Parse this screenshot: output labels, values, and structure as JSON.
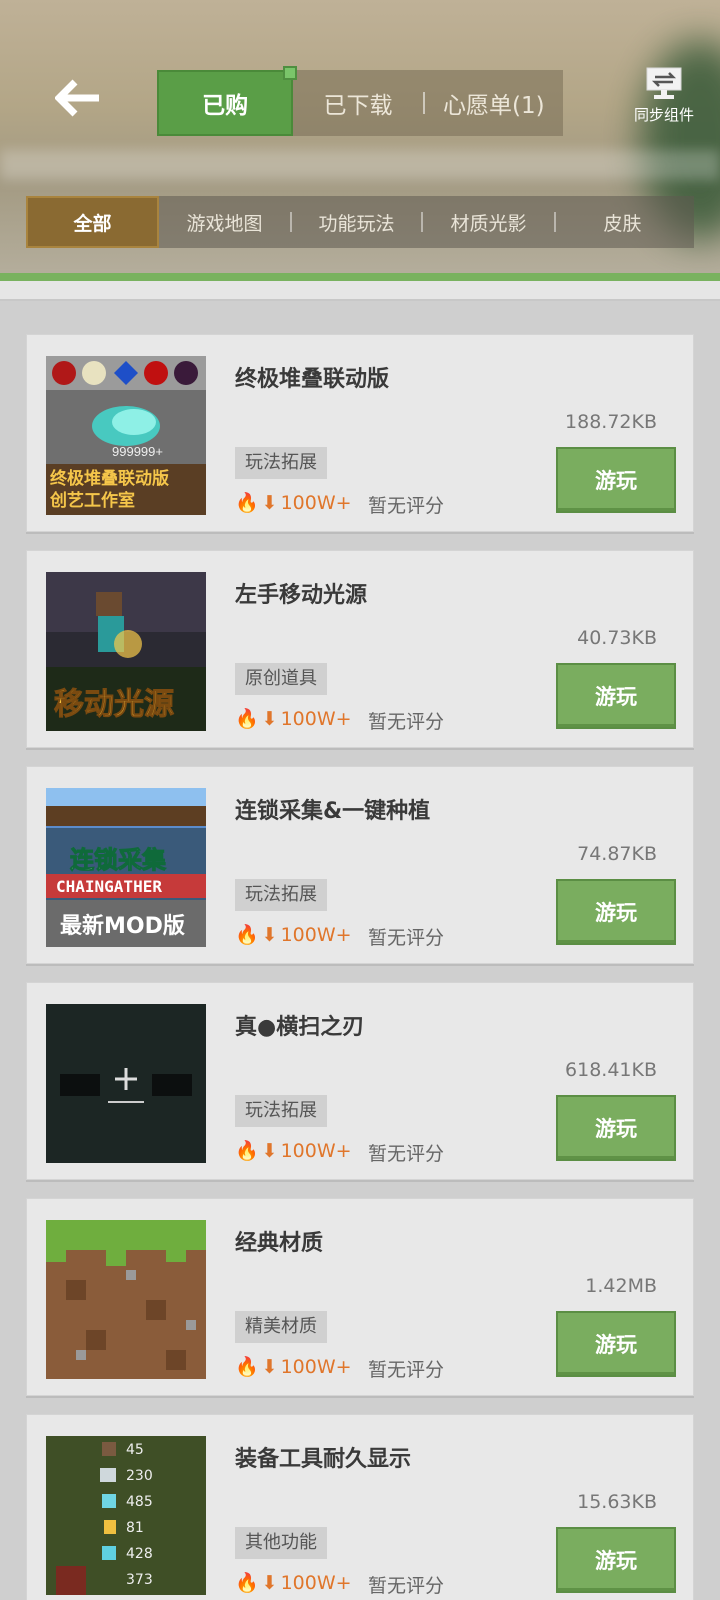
{
  "header": {
    "tabs": [
      {
        "label": "已购",
        "active": true
      },
      {
        "label": "已下载",
        "active": false
      },
      {
        "label": "心愿单(1)",
        "active": false
      }
    ],
    "sync_label": "同步组件"
  },
  "categories": [
    {
      "label": "全部",
      "active": true
    },
    {
      "label": "游戏地图",
      "active": false
    },
    {
      "label": "功能玩法",
      "active": false
    },
    {
      "label": "材质光影",
      "active": false
    },
    {
      "label": "皮肤",
      "active": false
    }
  ],
  "items": [
    {
      "name": "终极堆叠联动版",
      "size": "188.72KB",
      "tag": "玩法拓展",
      "downloads": "100W+",
      "rating": "暂无评分",
      "button": "游玩",
      "thumb_text": [
        "999999+",
        "终极堆叠联动版",
        "创艺工作室"
      ]
    },
    {
      "name": "左手移动光源",
      "size": "40.73KB",
      "tag": "原创道具",
      "downloads": "100W+",
      "rating": "暂无评分",
      "button": "游玩",
      "thumb_text": [
        "移动光源"
      ]
    },
    {
      "name": "连锁采集&一键种植",
      "size": "74.87KB",
      "tag": "玩法拓展",
      "downloads": "100W+",
      "rating": "暂无评分",
      "button": "游玩",
      "thumb_text": [
        "连锁采集",
        "CHAINGATHER",
        "最新MOD版"
      ]
    },
    {
      "name": "真●横扫之刃",
      "size": "618.41KB",
      "tag": "玩法拓展",
      "downloads": "100W+",
      "rating": "暂无评分",
      "button": "游玩",
      "thumb_text": []
    },
    {
      "name": "经典材质",
      "size": "1.42MB",
      "tag": "精美材质",
      "downloads": "100W+",
      "rating": "暂无评分",
      "button": "游玩",
      "thumb_text": []
    },
    {
      "name": "装备工具耐久显示",
      "size": "15.63KB",
      "tag": "其他功能",
      "downloads": "100W+",
      "rating": "暂无评分",
      "button": "游玩",
      "thumb_text": [
        "45",
        "230",
        "485",
        "81",
        "428",
        "373"
      ]
    }
  ],
  "colors": {
    "accent_green": "#5a9e47",
    "play_button": "#7aad5f",
    "category_active": "#8a6a32",
    "hot_orange": "#e0762b"
  }
}
